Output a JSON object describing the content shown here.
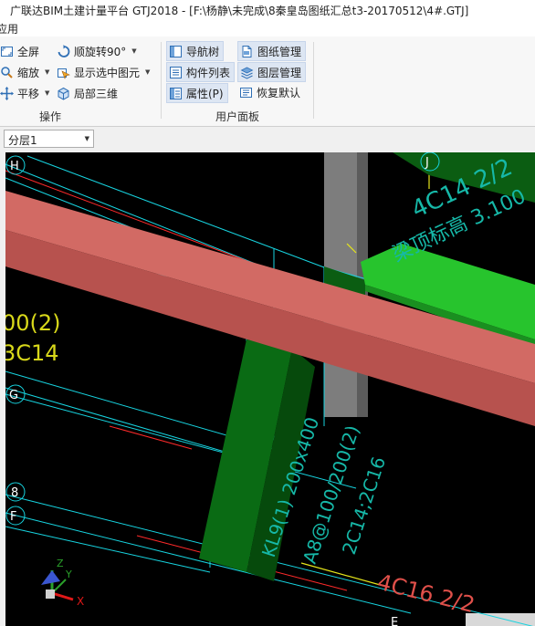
{
  "window": {
    "title": "广联达BIM土建计量平台 GTJ2018 - [F:\\杨静\\未完成\\8秦皇岛图纸汇总t3-20170512\\4#.GTJ]"
  },
  "menu": {
    "partial_label": "应用"
  },
  "ribbon": {
    "operations": {
      "group_label": "操作",
      "fullscreen": "全屏",
      "rotate_cw": "顺旋转90°",
      "zoom": "缩放",
      "show_selected": "显示选中图元",
      "pan": "平移",
      "local_3d": "局部三维"
    },
    "user_panel": {
      "group_label": "用户面板",
      "nav_tree": "导航树",
      "drawing_mgmt": "图纸管理",
      "component_list": "构件列表",
      "layer_mgmt": "图层管理",
      "properties": "属性(P)",
      "restore_default": "恢复默认"
    }
  },
  "layer_select": {
    "value": "分层1"
  },
  "viewport": {
    "axis_labels": {
      "H": "H",
      "J": "J",
      "G": "G",
      "n8": "8",
      "F": "F",
      "E": "E"
    },
    "annotations": {
      "top_right_1": "4C14 2/2",
      "top_right_2": "梁顶标高 3.100",
      "left_1": "00(2)",
      "left_2": "3C14",
      "beam_1": "KL9(1) 200x400",
      "beam_2": "A8@100/200(2)",
      "beam_3": "2C14;2C16",
      "bottom_right": "4C16 2/2"
    },
    "axes_gizmo": {
      "x": "X",
      "y": "Y",
      "z": "Z"
    }
  }
}
